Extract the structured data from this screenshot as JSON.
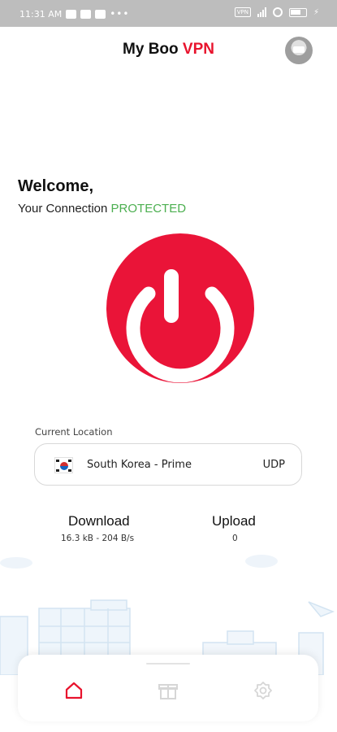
{
  "status_bar": {
    "time": "11:31 AM",
    "vpn_badge": "VPN",
    "more": "•••",
    "charging_symbol": "⚡"
  },
  "header": {
    "title_prefix": "My Boo ",
    "title_accent": "VPN",
    "accent_color": "#e8132d"
  },
  "welcome": {
    "heading": "Welcome,",
    "connection_prefix": "Your Connection ",
    "connection_status": "PROTECTED",
    "status_color": "#4caf50"
  },
  "power_button": {
    "icon": "power-icon",
    "color": "#ea1438"
  },
  "location": {
    "label": "Current Location",
    "flag_icon": "south-korea-flag-icon",
    "name": "South Korea - Prime",
    "protocol": "UDP"
  },
  "stats": {
    "download_label": "Download",
    "download_value": "16.3 kB - 204 B/s",
    "upload_label": "Upload",
    "upload_value": "0"
  },
  "bottom_nav": {
    "items": [
      {
        "icon": "home-icon",
        "active": true,
        "color": "#e8132d"
      },
      {
        "icon": "gift-icon",
        "active": false,
        "color": "#d6d6d6"
      },
      {
        "icon": "badge-icon",
        "active": false,
        "color": "#d6d6d6"
      }
    ]
  }
}
